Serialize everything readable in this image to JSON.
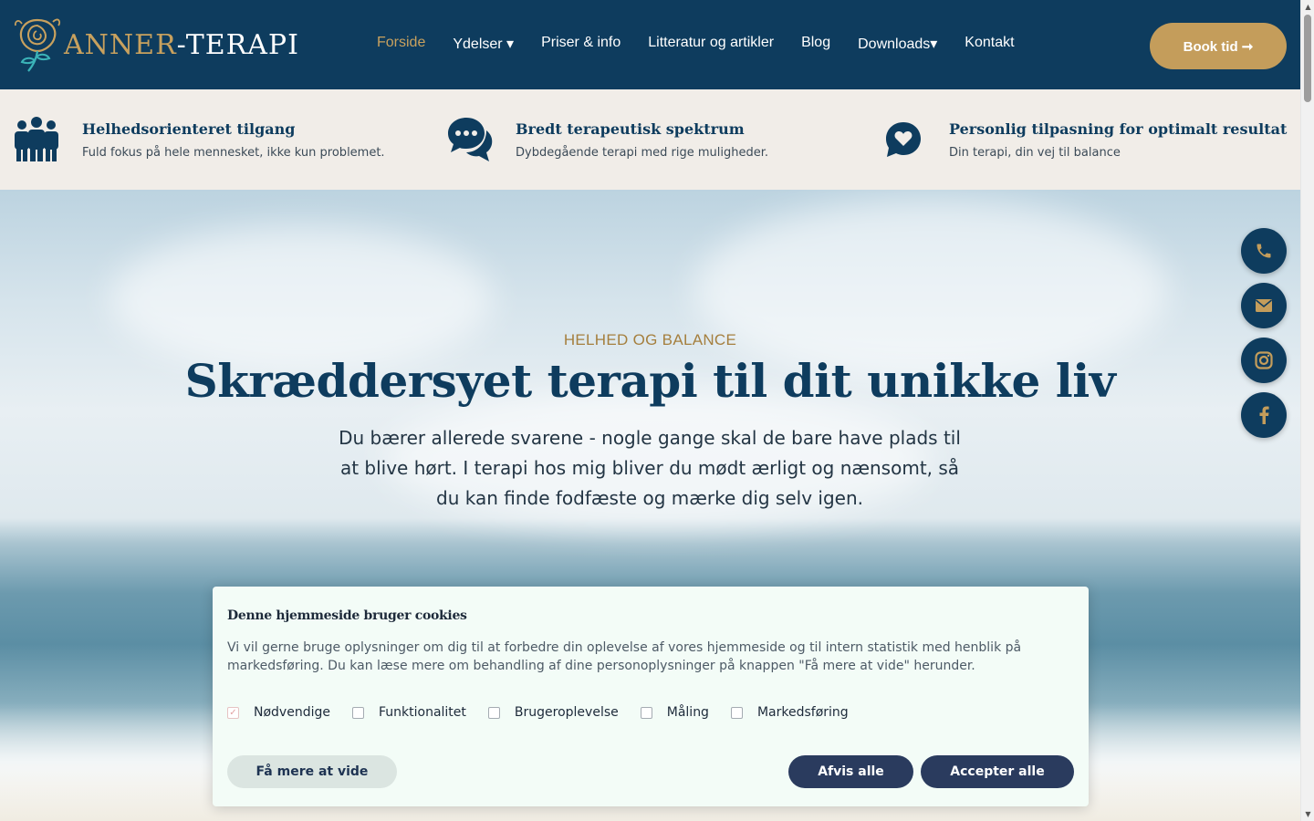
{
  "header": {
    "logo": {
      "part_a": "ANNER",
      "part_b": "-TERAPI"
    },
    "nav": [
      {
        "label": "Forside",
        "active": true
      },
      {
        "label": "Ydelser ▾"
      },
      {
        "label": "Priser & info"
      },
      {
        "label": "Litteratur og artikler"
      },
      {
        "label": "Blog"
      },
      {
        "label": "Downloads▾"
      },
      {
        "label": "Kontakt"
      }
    ],
    "book_button": "Book tid ➞"
  },
  "features": [
    {
      "icon": "group-icon",
      "title": "Helhedsorienteret tilgang",
      "subtitle": "Fuld fokus på hele mennesket, ikke kun problemet."
    },
    {
      "icon": "chat-bubbles-icon",
      "title": "Bredt terapeutisk spektrum",
      "subtitle": "Dybdegående terapi med rige muligheder."
    },
    {
      "icon": "heart-bubble-icon",
      "title": "Personlig tilpasning for optimalt resultat",
      "subtitle": "Din terapi, din vej til balance"
    }
  ],
  "hero": {
    "eyebrow": "HELHED OG BALANCE",
    "title": "Skræddersyet terapi til dit unikke liv",
    "text": "Du bærer allerede svarene - nogle gange skal de bare have plads til at blive hørt. I terapi hos mig bliver du mødt ærligt og nænsomt, så du kan finde fodfæste og mærke dig selv igen."
  },
  "social": [
    "phone-icon",
    "mail-icon",
    "instagram-icon",
    "facebook-icon"
  ],
  "cookie": {
    "title": "Denne hjemmeside bruger cookies",
    "body": "Vi vil gerne bruge oplysninger om dig til at forbedre din oplevelse af vores hjemmeside og til intern statistik med henblik på markedsføring. Du kan læse mere om behandling af dine personoplysninger på knappen \"Få mere at vide\" herunder.",
    "options": [
      {
        "label": "Nødvendige",
        "checked": true
      },
      {
        "label": "Funktionalitet",
        "checked": false
      },
      {
        "label": "Brugeroplevelse",
        "checked": false
      },
      {
        "label": "Måling",
        "checked": false
      },
      {
        "label": "Markedsføring",
        "checked": false
      }
    ],
    "more_button": "Få mere at vide",
    "reject_button": "Afvis alle",
    "accept_button": "Accepter alle"
  },
  "colors": {
    "primary": "#0e3c5e",
    "gold": "#c49d5b",
    "cookie_button": "#2a3b5e"
  }
}
